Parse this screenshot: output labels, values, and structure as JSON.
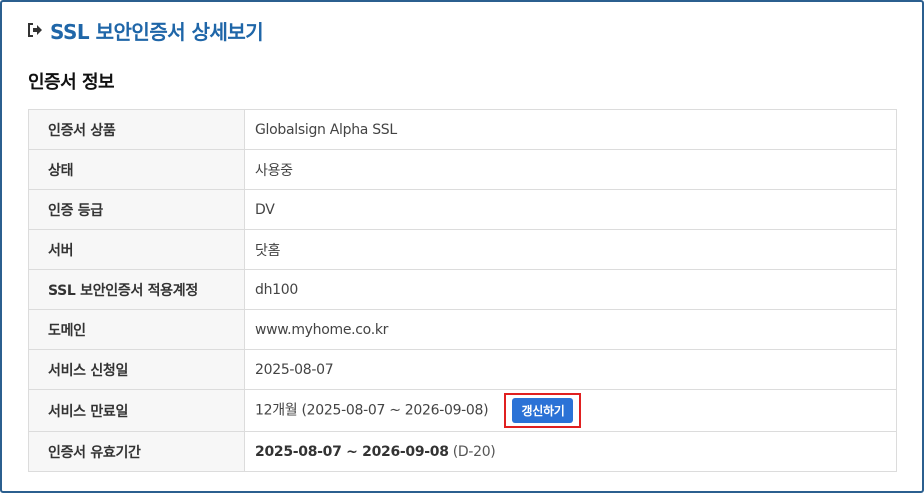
{
  "header": {
    "title": "SSL 보안인증서 상세보기",
    "title_icon": "sign-out-icon",
    "accent_color": "#1f66a8"
  },
  "section": {
    "title": "인증서 정보"
  },
  "rows": [
    {
      "label": "인증서 상품",
      "value": "Globalsign Alpha SSL"
    },
    {
      "label": "상태",
      "value": "사용중"
    },
    {
      "label": "인증 등급",
      "value": "DV"
    },
    {
      "label": "서버",
      "value": "닷홈"
    },
    {
      "label": "SSL 보안인증서 적용계정",
      "value": "dh100"
    },
    {
      "label": "도메인",
      "value": "www.myhome.co.kr"
    },
    {
      "label": "서비스 신청일",
      "value": "2025-08-07"
    },
    {
      "label": "서비스 만료일",
      "value": "12개월 (2025-08-07 ~ 2026-09-08)",
      "button": "갱신하기"
    },
    {
      "label": "인증서 유효기간",
      "value_strong": "2025-08-07 ~ 2026-09-08",
      "value_extra": "(D-20)"
    }
  ],
  "colors": {
    "button": "#2b72d6",
    "highlight_border": "#e02020",
    "frame_border": "#2b5f8f"
  }
}
